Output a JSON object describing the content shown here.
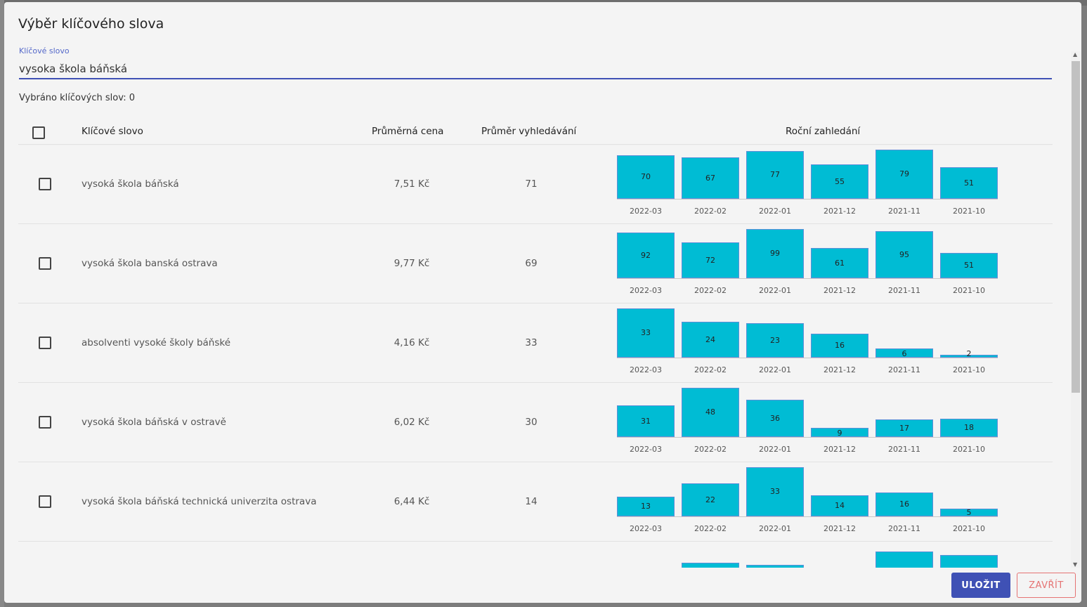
{
  "dialog": {
    "title": "Výběr klíčového slova",
    "field_label": "Klíčové slovo",
    "field_value": "vysoka škola báňská",
    "selected_count": "Vybráno klíčových slov: 0",
    "save_label": "ULOŽIT",
    "close_label": "ZAVŘÍT"
  },
  "table": {
    "headers": {
      "keyword": "Klíčové slovo",
      "price": "Průměrná cena",
      "avg_search": "Průměr vyhledávání",
      "yearly": "Roční zahledání"
    },
    "months": [
      "2022-03",
      "2022-02",
      "2022-01",
      "2021-12",
      "2021-11",
      "2021-10"
    ],
    "rows": [
      {
        "keyword": "vysoká škola báňská",
        "price": "7,51 Kč",
        "avg": "71",
        "values": [
          70,
          67,
          77,
          55,
          79,
          51
        ]
      },
      {
        "keyword": "vysoká škola banská ostrava",
        "price": "9,77 Kč",
        "avg": "69",
        "values": [
          92,
          72,
          99,
          61,
          95,
          51
        ]
      },
      {
        "keyword": "absolventi vysoké školy báňské",
        "price": "4,16 Kč",
        "avg": "33",
        "values": [
          33,
          24,
          23,
          16,
          6,
          2
        ]
      },
      {
        "keyword": "vysoká škola báňská v ostravě",
        "price": "6,02 Kč",
        "avg": "30",
        "values": [
          31,
          48,
          36,
          9,
          17,
          18
        ]
      },
      {
        "keyword": "vysoká škola báňská technická univerzita ostrava",
        "price": "6,44 Kč",
        "avg": "14",
        "values": [
          13,
          22,
          33,
          14,
          16,
          5
        ]
      }
    ]
  },
  "colors": {
    "accent": "#3f51b5",
    "bar": "#00bcd4",
    "close": "#e57373"
  }
}
